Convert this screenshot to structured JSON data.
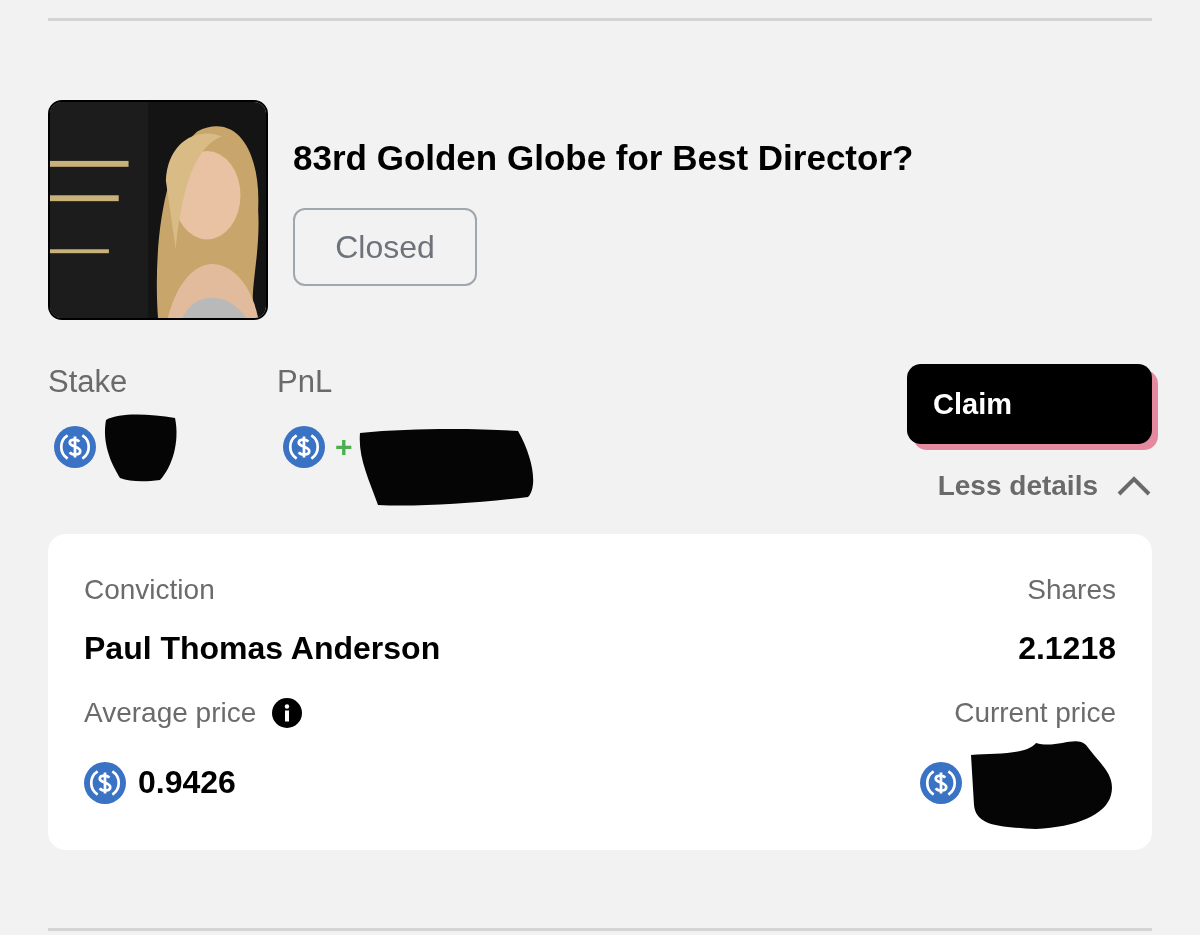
{
  "market": {
    "title": "83rd Golden Globe for Best Director?",
    "status": "Closed"
  },
  "position": {
    "stake_label": "Stake",
    "pnl_label": "PnL",
    "pnl_sign": "+",
    "claim_button": "Claim",
    "details_toggle": "Less details",
    "expanded": true
  },
  "details": {
    "conviction_label": "Conviction",
    "conviction": "Paul Thomas Anderson",
    "shares_label": "Shares",
    "shares": "2.1218",
    "average_price_label": "Average price",
    "average_price": "0.9426",
    "current_price_label": "Current price"
  }
}
